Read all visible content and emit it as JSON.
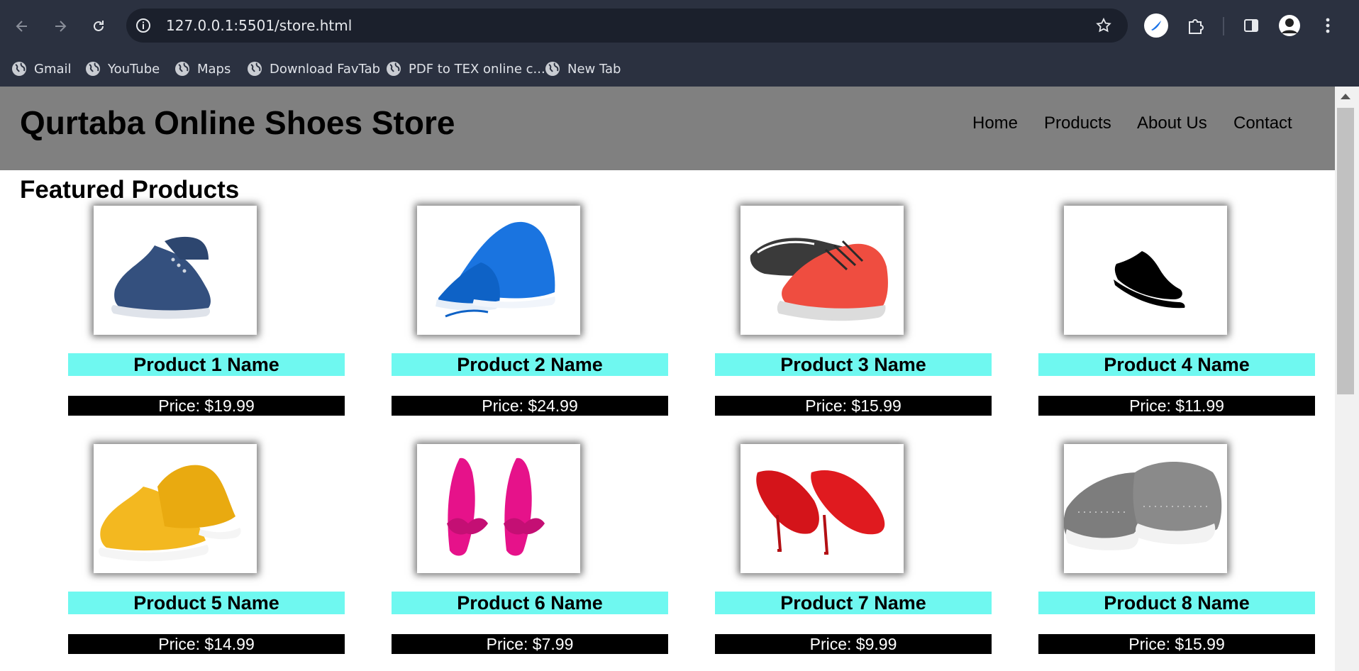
{
  "browser": {
    "url": "127.0.0.1:5501/store.html",
    "bookmarks": [
      {
        "label": "Gmail"
      },
      {
        "label": "YouTube"
      },
      {
        "label": "Maps"
      },
      {
        "label": "Download FavTab"
      },
      {
        "label": "PDF to TEX online c..."
      },
      {
        "label": "New Tab"
      }
    ]
  },
  "site": {
    "title": "Qurtaba Online Shoes Store",
    "nav": [
      "Home",
      "Products",
      "About Us",
      "Contact"
    ],
    "section_title": "Featured Products"
  },
  "products": [
    {
      "name": "Product 1 Name",
      "price": "Price: $19.99",
      "image": "blue canvas sneaker"
    },
    {
      "name": "Product 2 Name",
      "price": "Price: $24.99",
      "image": "blue running shoes"
    },
    {
      "name": "Product 3 Name",
      "price": "Price: $15.99",
      "image": "red running shoes"
    },
    {
      "name": "Product 4 Name",
      "price": "Price: $11.99",
      "image": "black sneaker icon"
    },
    {
      "name": "Product 5 Name",
      "price": "Price: $14.99",
      "image": "yellow canvas sneakers"
    },
    {
      "name": "Product 6 Name",
      "price": "Price: $7.99",
      "image": "pink bow heels"
    },
    {
      "name": "Product 7 Name",
      "price": "Price: $9.99",
      "image": "red high heels"
    },
    {
      "name": "Product 8 Name",
      "price": "Price: $15.99",
      "image": "grey dotted sneakers"
    }
  ],
  "colors": {
    "header_bg": "#808080",
    "name_bar": "#6ff8f0",
    "price_bar": "#000000",
    "browser_chrome": "#2b3140"
  }
}
